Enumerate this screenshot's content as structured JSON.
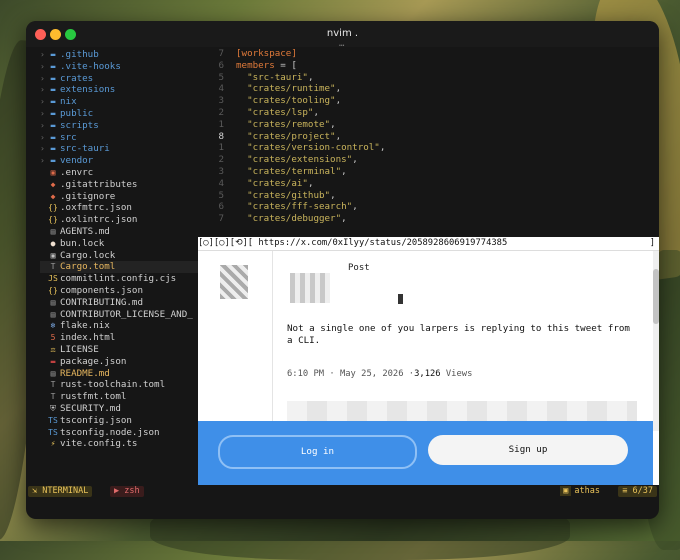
{
  "window": {
    "title": "nvim .",
    "subtitle": "…"
  },
  "traffic_lights": {
    "close": "#fe5f57",
    "minimize": "#febc2e",
    "maximize": "#28c840"
  },
  "tree": [
    {
      "kind": "dir",
      "name": ".github"
    },
    {
      "kind": "dir",
      "name": ".vite-hooks"
    },
    {
      "kind": "dir",
      "name": "crates"
    },
    {
      "kind": "dir",
      "name": "extensions"
    },
    {
      "kind": "dir",
      "name": "nix"
    },
    {
      "kind": "dir",
      "name": "public"
    },
    {
      "kind": "dir",
      "name": "scripts"
    },
    {
      "kind": "dir",
      "name": "src"
    },
    {
      "kind": "dir",
      "name": "src-tauri"
    },
    {
      "kind": "dir",
      "name": "vendor"
    },
    {
      "kind": "file",
      "name": ".envrc",
      "icon": "▣",
      "color": "#e06b4a"
    },
    {
      "kind": "file",
      "name": ".gitattributes",
      "icon": "◆",
      "color": "#e06b4a"
    },
    {
      "kind": "file",
      "name": ".gitignore",
      "icon": "◆",
      "color": "#e06b4a"
    },
    {
      "kind": "file",
      "name": ".oxfmtrc.json",
      "icon": "{}",
      "color": "#e7c25a"
    },
    {
      "kind": "file",
      "name": ".oxlintrc.json",
      "icon": "{}",
      "color": "#e7c25a"
    },
    {
      "kind": "file",
      "name": "AGENTS.md",
      "icon": "▤",
      "color": "#9a9a9a"
    },
    {
      "kind": "file",
      "name": "bun.lock",
      "icon": "●",
      "color": "#f0e0d0"
    },
    {
      "kind": "file",
      "name": "Cargo.lock",
      "icon": "▣",
      "color": "#c0c0c0"
    },
    {
      "kind": "file",
      "name": "Cargo.toml",
      "icon": "T",
      "color": "#9a9a9a",
      "modified": true,
      "selected": true
    },
    {
      "kind": "file",
      "name": "commitlint.config.cjs",
      "icon": "JS",
      "color": "#e7c25a"
    },
    {
      "kind": "file",
      "name": "components.json",
      "icon": "{}",
      "color": "#e7c25a"
    },
    {
      "kind": "file",
      "name": "CONTRIBUTING.md",
      "icon": "▤",
      "color": "#9a9a9a"
    },
    {
      "kind": "file",
      "name": "CONTRIBUTOR_LICENSE_AND_",
      "icon": "▤",
      "color": "#9a9a9a"
    },
    {
      "kind": "file",
      "name": "flake.nix",
      "icon": "❄",
      "color": "#7aa7e0"
    },
    {
      "kind": "file",
      "name": "index.html",
      "icon": "5",
      "color": "#e06b4a"
    },
    {
      "kind": "file",
      "name": "LICENSE",
      "icon": "⚖",
      "color": "#e7c25a"
    },
    {
      "kind": "file",
      "name": "package.json",
      "icon": "▬",
      "color": "#c04040"
    },
    {
      "kind": "file",
      "name": "README.md",
      "icon": "▤",
      "color": "#9a9a9a",
      "modified": true
    },
    {
      "kind": "file",
      "name": "rust-toolchain.toml",
      "icon": "T",
      "color": "#9a9a9a"
    },
    {
      "kind": "file",
      "name": "rustfmt.toml",
      "icon": "T",
      "color": "#9a9a9a"
    },
    {
      "kind": "file",
      "name": "SECURITY.md",
      "icon": "⛨",
      "color": "#c0c0c0"
    },
    {
      "kind": "file",
      "name": "tsconfig.json",
      "icon": "TS",
      "color": "#5a9ad6"
    },
    {
      "kind": "file",
      "name": "tsconfig.node.json",
      "icon": "TS",
      "color": "#5a9ad6"
    },
    {
      "kind": "file",
      "name": "vite.config.ts",
      "icon": "⚡",
      "color": "#e7c25a"
    }
  ],
  "editor_lines": [
    {
      "ln": "7",
      "parts": [
        [
          "kw",
          "[workspace]"
        ]
      ]
    },
    {
      "ln": "6",
      "parts": [
        [
          "kw",
          "members"
        ],
        [
          "punc",
          " = ["
        ]
      ]
    },
    {
      "ln": "5",
      "parts": [
        [
          "punc",
          "  "
        ],
        [
          "str",
          "\"src-tauri\""
        ],
        [
          "punc",
          ","
        ]
      ]
    },
    {
      "ln": "4",
      "parts": [
        [
          "punc",
          "  "
        ],
        [
          "str",
          "\"crates/runtime\""
        ],
        [
          "punc",
          ","
        ]
      ]
    },
    {
      "ln": "3",
      "parts": [
        [
          "punc",
          "  "
        ],
        [
          "str",
          "\"crates/tooling\""
        ],
        [
          "punc",
          ","
        ]
      ]
    },
    {
      "ln": "2",
      "parts": [
        [
          "punc",
          "  "
        ],
        [
          "str",
          "\"crates/lsp\""
        ],
        [
          "punc",
          ","
        ]
      ]
    },
    {
      "ln": "1",
      "parts": [
        [
          "punc",
          "  "
        ],
        [
          "str",
          "\"crates/remote\""
        ],
        [
          "punc",
          ","
        ]
      ]
    },
    {
      "ln": "8",
      "cur": true,
      "parts": [
        [
          "punc",
          "  "
        ],
        [
          "str",
          "\"crates/project\""
        ],
        [
          "punc",
          ","
        ]
      ]
    },
    {
      "ln": "1",
      "parts": [
        [
          "punc",
          "  "
        ],
        [
          "str",
          "\"crates/version-control\""
        ],
        [
          "punc",
          ","
        ]
      ]
    },
    {
      "ln": "2",
      "parts": [
        [
          "punc",
          "  "
        ],
        [
          "str",
          "\"crates/extensions\""
        ],
        [
          "punc",
          ","
        ]
      ]
    },
    {
      "ln": "3",
      "parts": [
        [
          "punc",
          "  "
        ],
        [
          "str",
          "\"crates/terminal\""
        ],
        [
          "punc",
          ","
        ]
      ]
    },
    {
      "ln": "4",
      "parts": [
        [
          "punc",
          "  "
        ],
        [
          "str",
          "\"crates/ai\""
        ],
        [
          "punc",
          ","
        ]
      ]
    },
    {
      "ln": "5",
      "parts": [
        [
          "punc",
          "  "
        ],
        [
          "str",
          "\"crates/github\""
        ],
        [
          "punc",
          ","
        ]
      ]
    },
    {
      "ln": "6",
      "parts": [
        [
          "punc",
          "  "
        ],
        [
          "str",
          "\"crates/fff-search\""
        ],
        [
          "punc",
          ","
        ]
      ]
    },
    {
      "ln": "7",
      "parts": [
        [
          "punc",
          "  "
        ],
        [
          "str",
          "\"crates/debugger\""
        ],
        [
          "punc",
          ","
        ]
      ]
    }
  ],
  "browser": {
    "url": "[◯][◯][⟲][ https://x.com/0xIlyy/status/2058928606919774385",
    "url_end": "]",
    "post_header": "Post",
    "tweet_text": "Not a single one of you larpers is replying to this tweet from a CLI.",
    "time": "6:10 PM · May 25, 2026 ·",
    "views_count": "3,126",
    "views_label": "Views",
    "login_label": "Log in",
    "signup_label": "Sign up"
  },
  "statusbar": {
    "terminal_label": "NTERMINAL",
    "terminal_icon": "⇲",
    "zsh_label": "zsh",
    "zsh_icon": "▶",
    "folder_icon": "▣",
    "project_label": "athas",
    "count_icon": "≡",
    "count": "6/37"
  }
}
